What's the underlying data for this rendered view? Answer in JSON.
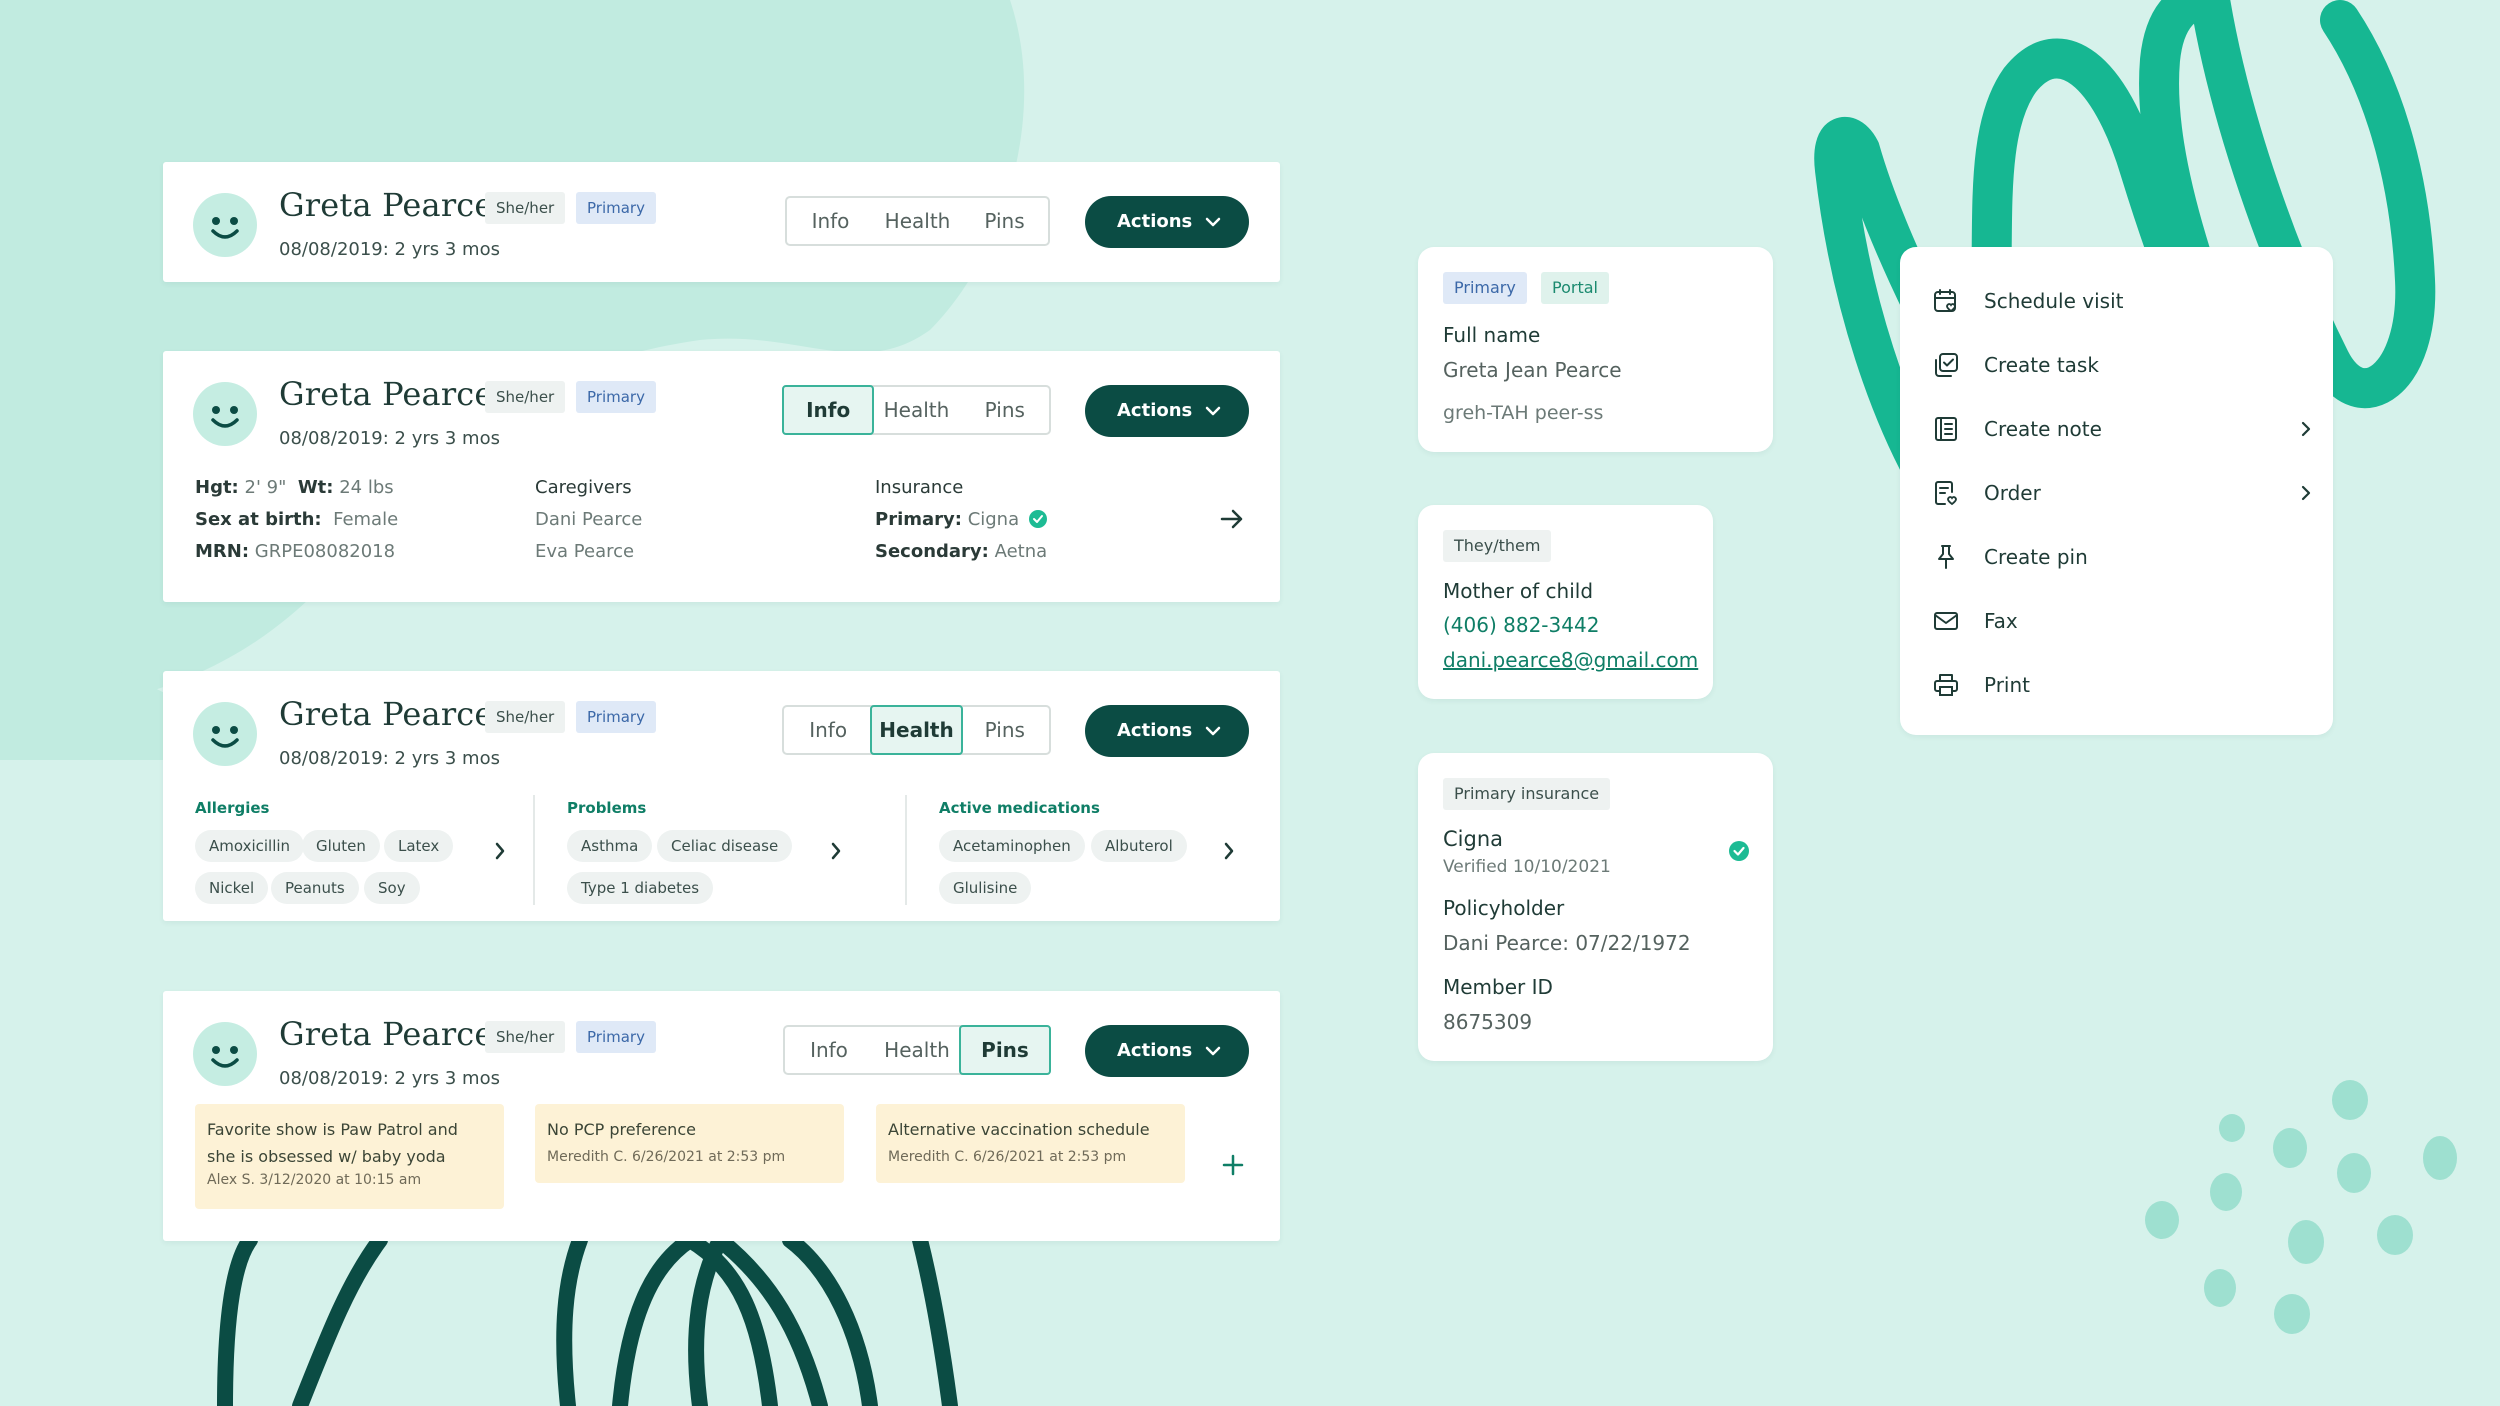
{
  "colors": {
    "background": "#d6f2eb",
    "dark_teal": "#0b4c44",
    "accent_green": "#1dbb94",
    "blob": "#b2e8dc",
    "tag_primary_bg": "#dfe9f7",
    "note_bg": "#fdf2d6"
  },
  "patient": {
    "name": "Greta Pearce",
    "pronouns": "She/her",
    "primary_tag": "Primary",
    "dob": "08/08/2019: 2 yrs 3 mos"
  },
  "tabs": {
    "info": "Info",
    "health": "Health",
    "pins": "Pins"
  },
  "actions_label": "Actions",
  "info": {
    "hgt_label": "Hgt:",
    "hgt_value": "2' 9\"",
    "wt_label": "Wt:",
    "wt_value": "24 lbs",
    "sex_label": "Sex at birth:",
    "sex_value": "Female",
    "mrn_label": "MRN:",
    "mrn_value": "GRPE08082018",
    "caregivers_label": "Caregivers",
    "caregivers": [
      "Dani Pearce",
      "Eva Pearce"
    ],
    "insurance_label": "Insurance",
    "primary_label": "Primary:",
    "primary_value": "Cigna",
    "secondary_label": "Secondary:",
    "secondary_value": "Aetna"
  },
  "health": {
    "allergies_label": "Allergies",
    "allergies": [
      "Amoxicillin",
      "Gluten",
      "Latex",
      "Nickel",
      "Peanuts",
      "Soy"
    ],
    "problems_label": "Problems",
    "problems": [
      "Asthma",
      "Celiac disease",
      "Type 1 diabetes"
    ],
    "meds_label": "Active medications",
    "meds": [
      "Acetaminophen",
      "Albuterol",
      "Glulisine"
    ]
  },
  "pins": [
    {
      "text1": "Favorite show is Paw Patrol and",
      "text2": "she is obsessed w/ baby yoda",
      "meta": "Alex S. 3/12/2020 at 10:15 am"
    },
    {
      "text1": "No PCP preference",
      "text2": "",
      "meta": "Meredith C. 6/26/2021 at 2:53 pm"
    },
    {
      "text1": "Alternative vaccination schedule",
      "text2": "",
      "meta": "Meredith C. 6/26/2021 at 2:53 pm"
    }
  ],
  "name_card": {
    "tag_primary": "Primary",
    "tag_portal": "Portal",
    "full_name_label": "Full name",
    "full_name": "Greta Jean Pearce",
    "phonetic": "greh-TAH peer-ss"
  },
  "contact_card": {
    "pronouns": "They/them",
    "relation": "Mother of child",
    "phone": "(406) 882-3442",
    "email": "dani.pearce8@gmail.com"
  },
  "insurance_card": {
    "tag": "Primary insurance",
    "carrier": "Cigna",
    "verified": "Verified 10/10/2021",
    "policyholder_label": "Policyholder",
    "policyholder": "Dani Pearce: 07/22/1972",
    "member_id_label": "Member ID",
    "member_id": "8675309"
  },
  "menu": {
    "items": [
      {
        "label": "Schedule visit",
        "icon": "calendar-heart-icon",
        "submenu": false
      },
      {
        "label": "Create task",
        "icon": "task-icon",
        "submenu": false
      },
      {
        "label": "Create note",
        "icon": "note-icon",
        "submenu": true
      },
      {
        "label": "Order",
        "icon": "order-icon",
        "submenu": true
      },
      {
        "label": "Create pin",
        "icon": "pin-icon",
        "submenu": false
      },
      {
        "label": "Fax",
        "icon": "envelope-icon",
        "submenu": false
      },
      {
        "label": "Print",
        "icon": "printer-icon",
        "submenu": false
      }
    ]
  }
}
